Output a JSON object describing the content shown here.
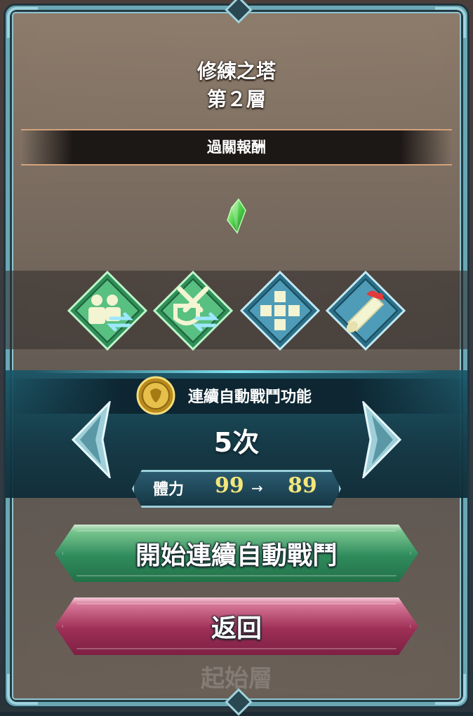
{
  "dialog": {
    "title": "修練之塔",
    "subtitle": "第２層"
  },
  "reward": {
    "header": "過關報酬",
    "item_icon": "green-crystal-icon"
  },
  "skills": [
    {
      "icon": "swap-ally-icon",
      "color": "#4fb579"
    },
    {
      "icon": "swap-sword-shield-icon",
      "color": "#4fb579"
    },
    {
      "icon": "cross-grid-icon",
      "color": "#4a93ad"
    },
    {
      "icon": "scroll-ribbon-icon",
      "color": "#4a93ad"
    }
  ],
  "auto_battle": {
    "label": "連續自動戰鬥功能",
    "count": "5次",
    "stamina_label": "體力",
    "stamina_from": "99",
    "stamina_arrow": "→",
    "stamina_to": "89"
  },
  "buttons": {
    "start_label": "開始連續自動戰鬥",
    "back_label": "返回"
  },
  "background": {
    "bottom_text": "起始層"
  }
}
